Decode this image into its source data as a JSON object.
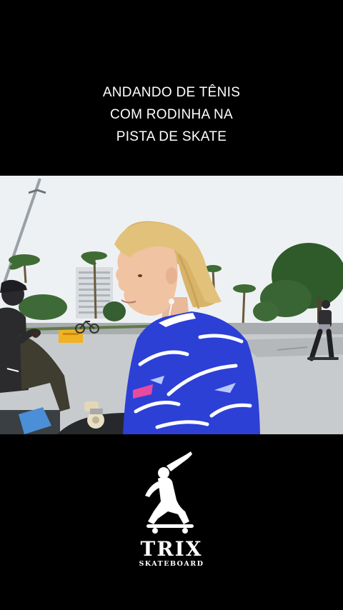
{
  "caption": {
    "lines": [
      "ANDANDO DE TÊNIS",
      "COM RODINHA NA",
      "PISTA DE SKATE"
    ]
  },
  "video": {
    "scene": "skate-park-interview",
    "colors": {
      "sky": "#eef1f3",
      "ground": "#c8cbcd",
      "hair": "#e2c27a",
      "shirt_blue": "#2c40d6",
      "barrier": "#f0b224"
    }
  },
  "logo": {
    "icon": "skateboarder-logo-icon",
    "brand": "TRIX",
    "tagline": "SKATEBOARD"
  }
}
